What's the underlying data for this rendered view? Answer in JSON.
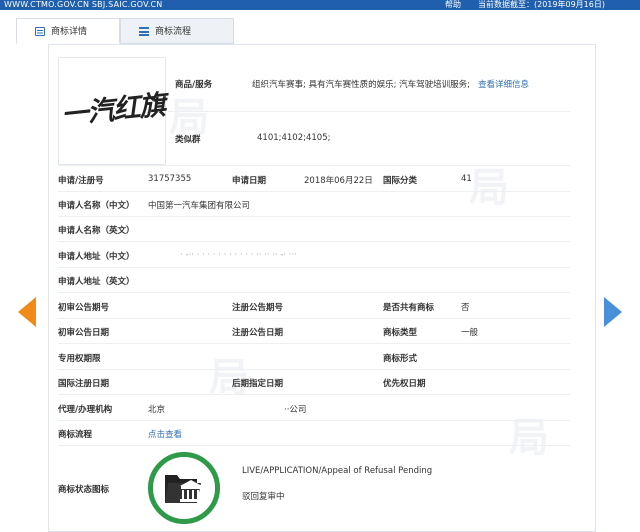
{
  "topbar": {
    "site_text": "WWW.CTMO.GOV.CN SBJ.SAIC.GOV.CN",
    "help_label": "帮助",
    "db_date": "当前数据截至：(2019年09月16日)"
  },
  "tabs": [
    {
      "label": "商标详情",
      "active": true,
      "icon": "document-icon"
    },
    {
      "label": "商标流程",
      "active": false,
      "icon": "list-icon"
    }
  ],
  "logo": {
    "text": "一汽红旗"
  },
  "detail": {
    "goods_label": "商品/服务",
    "goods_value": "组织汽车赛事; 具有汽车赛性质的娱乐; 汽车驾驶培训服务;",
    "goods_link": "查看详细信息",
    "class_group_label": "类似群",
    "class_group_value": "4101;4102;4105;",
    "reg_no_label": "申请/注册号",
    "reg_no_value": "31757355",
    "app_date_label": "申请日期",
    "app_date_value": "2018年06月22日",
    "intl_class_label": "国际分类",
    "intl_class_value": "41",
    "applicant_cn_label": "申请人名称（中文）",
    "applicant_cn_value": "中国第一汽车集团有限公司",
    "applicant_en_label": "申请人名称（英文）",
    "address_cn_label": "申请人地址（中文）",
    "address_cn_value": "· -··  ·  ·  ·   ·  ·  ·  ·  ·  ·   ·  ·  ··  ·· ·· -· ···",
    "address_en_label": "申请人地址（英文）",
    "prelim_no_label": "初审公告期号",
    "reg_pub_no_label": "注册公告期号",
    "shared_label": "是否共有商标",
    "shared_value": "否",
    "prelim_date_label": "初审公告日期",
    "reg_pub_date_label": "注册公告日期",
    "tm_type_label": "商标类型",
    "tm_type_value": "一般",
    "exclusive_label": "专用权期限",
    "tm_form_label": "商标形式",
    "intl_reg_date_label": "国际注册日期",
    "later_date_label": "后期指定日期",
    "priority_date_label": "优先权日期",
    "agent_label": "代理/办理机构",
    "agent_value_1": "北京",
    "agent_value_2": "··公司",
    "process_label": "商标流程",
    "process_link": "点击查看",
    "status_label": "商标状态图标",
    "status_en": "LIVE/APPLICATION/Appeal of Refusal Pending",
    "status_cn": "驳回复审中"
  },
  "colors": {
    "topbar": "#1f5fae",
    "link": "#2f6fb7",
    "arrow_left": "#f08b17",
    "arrow_right": "#4a90d9",
    "status_ring": "#2f9a4a"
  },
  "icons": {
    "prev": "arrow-left-icon",
    "next": "arrow-right-icon",
    "status": "folder-courthouse-icon"
  }
}
